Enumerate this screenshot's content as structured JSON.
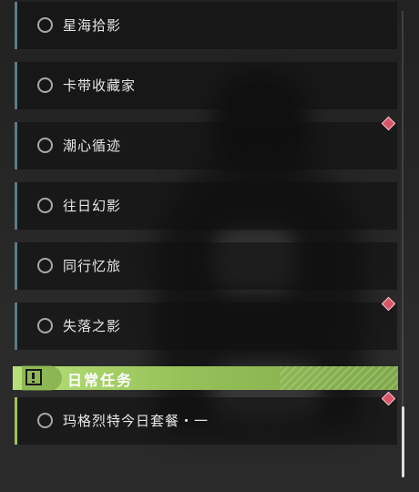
{
  "quests": [
    {
      "label": "星海拾影"
    },
    {
      "label": "卡带收藏家"
    },
    {
      "label": "潮心循迹"
    },
    {
      "label": "往日幻影"
    },
    {
      "label": "同行忆旅"
    },
    {
      "label": "失落之影"
    }
  ],
  "daily_section": {
    "title": "日常任务",
    "icon": "exclamation-box-icon",
    "items": [
      {
        "label": "玛格烈特今日套餐・一"
      }
    ]
  },
  "colors": {
    "accent_green": "#9cc25e",
    "marker_red": "#d9566a",
    "quest_bar": "#5b7a88"
  }
}
